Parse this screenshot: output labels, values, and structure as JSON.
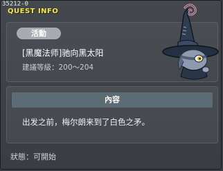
{
  "window": {
    "quest_id": "35212-0",
    "title": "QUEST INFO"
  },
  "quest": {
    "category_badge": "活動",
    "name": "[黑魔法师]驰向黑太阳",
    "level_requirement": "建議等級：200～204"
  },
  "content": {
    "header": "內容",
    "text": "出发之前，梅尔朗来到了白色之矛。"
  },
  "status": {
    "text": "狀態：可開始"
  },
  "npc": {
    "icon": "witch-hat-npc-icon"
  },
  "colors": {
    "title": "#f2e64a",
    "badge": "#a8acb2",
    "content_header": "#5d6b75",
    "window_bg": "#3d4045"
  }
}
